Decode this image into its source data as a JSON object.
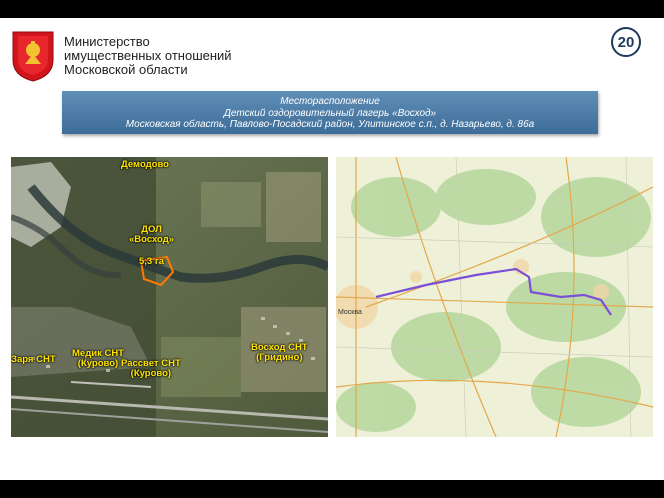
{
  "header": {
    "ministry_line1": "Министерство",
    "ministry_line2": "имущественных отношений",
    "ministry_line3": "Московской области",
    "page_number": "20"
  },
  "banner": {
    "line1": "Месторасположение",
    "line2": "Детский оздоровительный лагерь «Восход»",
    "line3": "Московская область, Павлово-Посадский район, Улитинское с.п., д. Назарьево, д. 86а"
  },
  "aerial": {
    "village": "Демодово",
    "camp_line1": "ДОЛ",
    "camp_line2": "«Восход»",
    "area": "5,3 га",
    "snt_zarya": "Заря СНТ",
    "snt_medik_line1": "Медик СНТ",
    "snt_medik_line2": "(Курово)",
    "snt_rassvet_line1": "Рассвет СНТ",
    "snt_rassvet_line2": "(Курово)",
    "snt_voskhod_line1": "Восход СНТ",
    "snt_voskhod_line2": "(Гридино)"
  },
  "map": {
    "city": "Москва"
  },
  "colors": {
    "label_yellow": "#ffe400",
    "banner_blue": "#4a78a3",
    "route": "#7b4fd6",
    "plot_outline": "#ff7a00"
  }
}
